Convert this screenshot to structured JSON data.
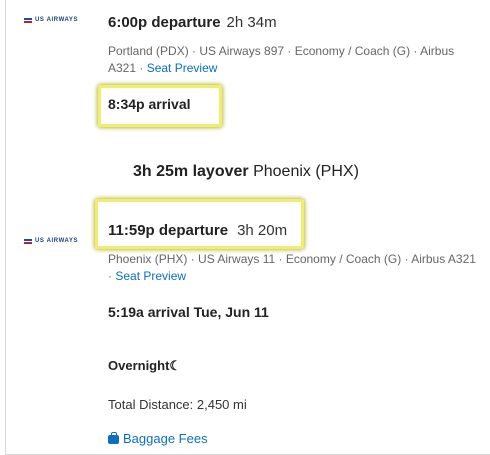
{
  "segment1": {
    "airline_logo": "US AIRWAYS",
    "departure_time": "6:00p departure",
    "duration": "2h 34m",
    "details_line1": "Portland (PDX) · US Airways 897 · Economy / Coach (G) · Airbus",
    "details_line2": "A321 ·",
    "seat_preview": "Seat Preview",
    "arrival": "8:34p arrival"
  },
  "layover": {
    "duration": "3h 25m layover",
    "location": "Phoenix (PHX)"
  },
  "segment2": {
    "airline_logo": "US AIRWAYS",
    "departure_time": "11:59p departure",
    "duration": "3h 20m",
    "details_line1": "Phoenix (PHX) · US Airways 11 · Economy / Coach (G) · Airbus A321",
    "details_line2": "·",
    "seat_preview": "Seat Preview",
    "arrival": "5:19a arrival Tue, Jun 11"
  },
  "overnight": "Overnight",
  "total_distance": "Total Distance: 2,450 mi",
  "baggage_fees": "Baggage Fees",
  "icons": {
    "moon": "moon-icon",
    "baggage": "briefcase-icon",
    "logo": "us-airways-flag-icon"
  },
  "colors": {
    "link": "#0a6fc2",
    "highlight": "#f0ee6a"
  }
}
